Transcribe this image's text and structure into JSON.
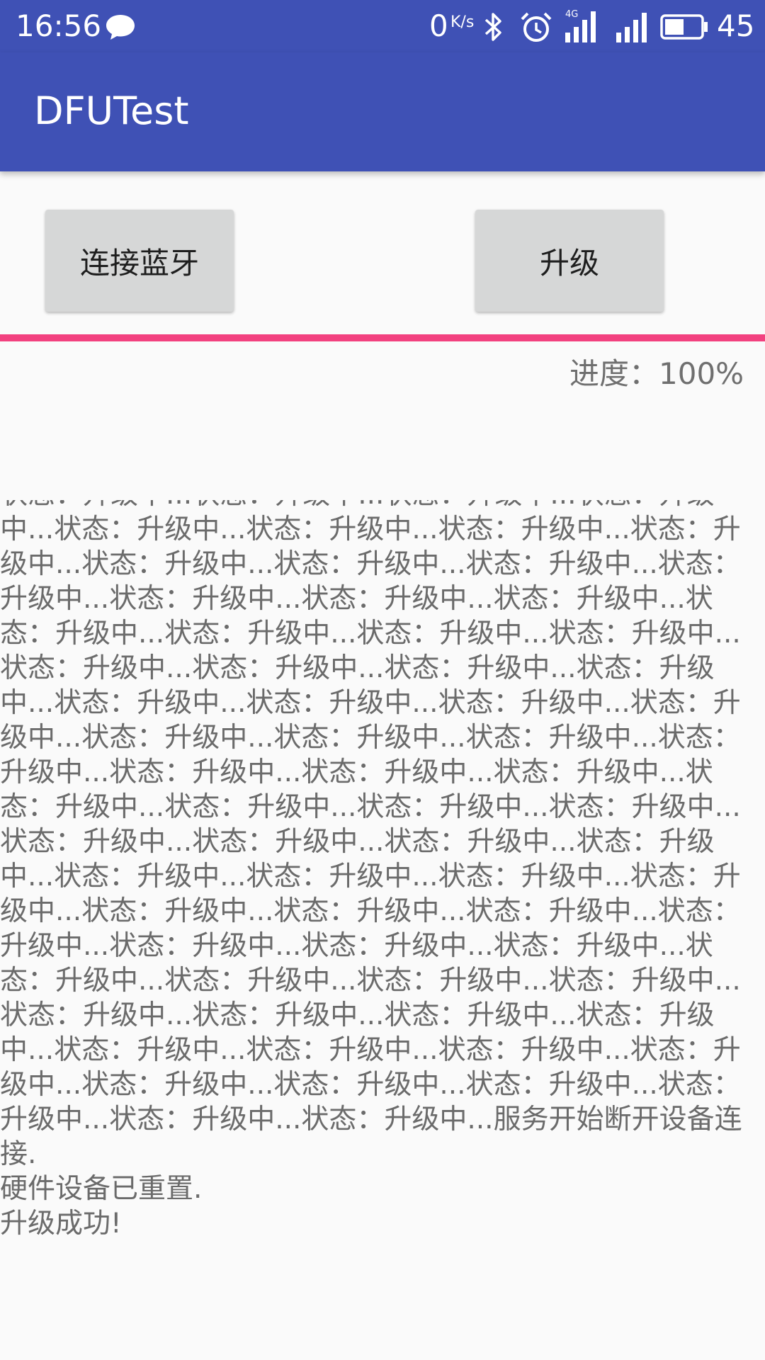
{
  "status_bar": {
    "time": "16:56",
    "notification_icon": "chat-bubble-icon",
    "net_speed_value": "0",
    "net_speed_unit": "K/s",
    "network_type": "4G",
    "battery_level": "45",
    "icons": [
      "bluetooth-icon",
      "alarm-icon",
      "signal-4g-icon",
      "signal-icon",
      "battery-icon"
    ]
  },
  "app_bar": {
    "title": "DFUTest"
  },
  "buttons": {
    "connect_label": "连接蓝牙",
    "upgrade_label": "升级"
  },
  "progress": {
    "label": "进度：100%",
    "fraction": 1.0
  },
  "log": {
    "text": "状态：升级中...状态：升级中...状态：升级中...状态：升级中...状态：升级中...状态：升级中...状态：升级中...状态：升级中...状态：升级中...状态：升级中...状态：升级中...状态：升级中...状态：升级中...状态：升级中...状态：升级中...状态：升级中...状态：升级中...状态：升级中...状态：升级中...状态：升级中...状态：升级中...状态：升级中...状态：升级中...状态：升级中...状态：升级中...状态：升级中...状态：升级中...状态：升级中...状态：升级中...状态：升级中...状态：升级中...状态：升级中...状态：升级中...状态：升级中...状态：升级中...状态：升级中...状态：升级中...状态：升级中...状态：升级中...状态：升级中...状态：升级中...状态：升级中...状态：升级中...状态：升级中...状态：升级中...状态：升级中...状态：升级中...状态：升级中...状态：升级中...状态：升级中...状态：升级中...状态：升级中...状态：升级中...状态：升级中...状态：升级中...状态：升级中...状态：升级中...状态：升级中...状态：升级中...状态：升级中...状态：升级中...状态：升级中...状态：升级中...状态：升级中...状态：升级中...状态：升级中...状态：升级中...状态：升级中...状态：升级中...状态：升级中...状态：升级中...服务开始断开设备连接.\n硬件设备已重置.\n升级成功!"
  },
  "colors": {
    "primary": "#3F51B5",
    "accent": "#F2417F",
    "button_bg": "#D6D7D7",
    "text_gray": "#6B6B6B"
  }
}
